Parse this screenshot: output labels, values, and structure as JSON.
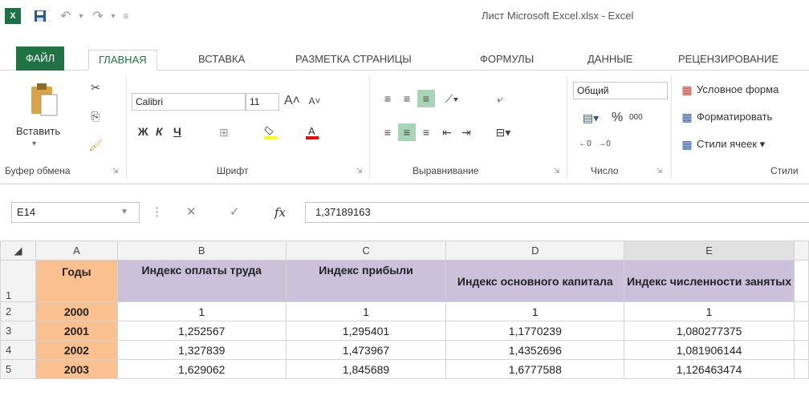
{
  "window": {
    "title": "Лист Microsoft Excel.xlsx - Excel",
    "app_logo": "X"
  },
  "qat": {
    "save_icon": "save-icon",
    "undo_icon": "undo-icon",
    "redo_icon": "redo-icon",
    "customize_icon": "customize-qat-icon"
  },
  "tabs": [
    "ФАЙЛ",
    "ГЛАВНАЯ",
    "ВСТАВКА",
    "РАЗМЕТКА СТРАНИЦЫ",
    "ФОРМУЛЫ",
    "ДАННЫЕ",
    "РЕЦЕНЗИРОВАНИЕ"
  ],
  "ribbon": {
    "clipboard": {
      "paste_label": "Вставить",
      "group_label": "Буфер обмена"
    },
    "font": {
      "font_name": "Calibri",
      "font_size": "11",
      "bold": "Ж",
      "italic": "К",
      "underline": "Ч",
      "group_label": "Шрифт"
    },
    "alignment": {
      "group_label": "Выравнивание"
    },
    "number": {
      "format": "Общий",
      "percent": "%",
      "thousands": "000",
      "group_label": "Число"
    },
    "styles": {
      "conditional": "Условное форма",
      "format_table": "Форматировать",
      "cell_styles": "Стили ячеек",
      "group_label": "Стили"
    }
  },
  "formula_bar": {
    "name_box": "E14",
    "fx": "fx",
    "value": "1,37189163"
  },
  "sheet": {
    "columns": [
      "A",
      "B",
      "C",
      "D",
      "E"
    ],
    "rows": [
      "1",
      "2",
      "3",
      "4",
      "5"
    ],
    "header": [
      "Годы",
      "Индекс оплаты труда",
      "Индекс прибыли",
      "Индекс основного капитала",
      "Индекс численности занятых"
    ],
    "data": [
      [
        "2000",
        "1",
        "1",
        "1",
        "1"
      ],
      [
        "2001",
        "1,252567",
        "1,295401",
        "1,1770239",
        "1,080277375"
      ],
      [
        "2002",
        "1,327839",
        "1,473967",
        "1,4352696",
        "1,081906144"
      ],
      [
        "2003",
        "1,629062",
        "1,845689",
        "1,6777588",
        "1,126463474"
      ]
    ]
  },
  "colors": {
    "excel_green": "#217346",
    "years_fill": "#fac090",
    "header_fill": "#ccc0da"
  }
}
